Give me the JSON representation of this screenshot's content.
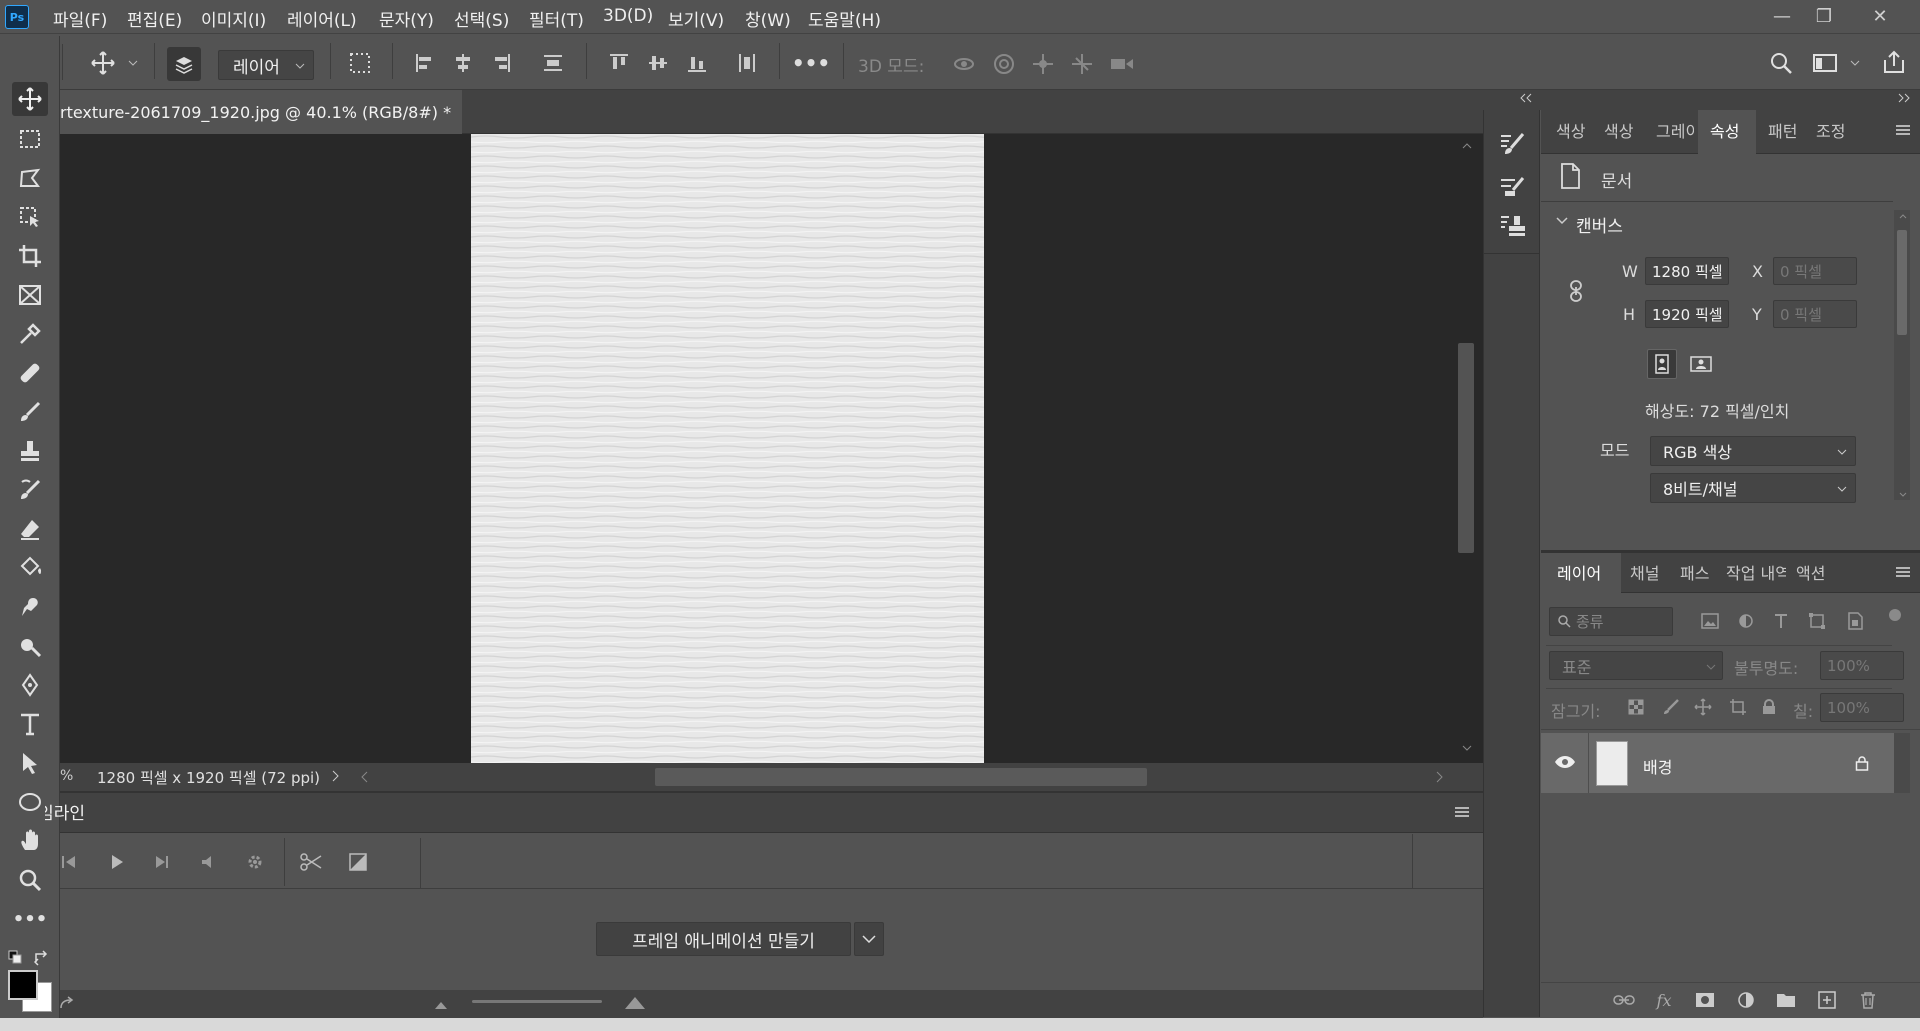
{
  "app": {
    "logo": "Ps"
  },
  "menu": [
    "파일(F)",
    "편집(E)",
    "이미지(I)",
    "레이어(L)",
    "문자(Y)",
    "선택(S)",
    "필터(T)",
    "3D(D)",
    "보기(V)",
    "창(W)",
    "도움말(H)"
  ],
  "window_controls": {
    "minimize": "—",
    "restore": "❐",
    "close": "✕"
  },
  "options_bar": {
    "layer_select": "레이어",
    "mode_label": "3D 모드:"
  },
  "document": {
    "tab_title": "rtexture-2061709_1920.jpg @ 40.1% (RGB/8#) *",
    "close": "×",
    "status_zoom": "%",
    "status_info": "1280 픽셀 x 1920 픽셀 (72 ppi)"
  },
  "timeline": {
    "title": "타임라인",
    "create_button": "프레임 애니메이션 만들기"
  },
  "properties": {
    "tabs": [
      "색상",
      "색상",
      "그레이",
      "속성",
      "패턴",
      "조정"
    ],
    "active_tab": 3,
    "doc_label": "문서",
    "canvas_section": "캔버스",
    "w_label": "W",
    "w_value": "1280 픽셀",
    "h_label": "H",
    "h_value": "1920 픽셀",
    "x_label": "X",
    "x_value": "0 픽셀",
    "y_label": "Y",
    "y_value": "0 픽셀",
    "resolution": "해상도: 72 픽셀/인치",
    "mode_label": "모드",
    "mode_value": "RGB 색상",
    "depth_value": "8비트/채널"
  },
  "layers": {
    "tabs": [
      "레이어",
      "채널",
      "패스",
      "작업 내역",
      "액션"
    ],
    "active_tab": 0,
    "filter_placeholder": "종류",
    "blend_mode": "표준",
    "opacity_label": "불투명도:",
    "opacity_value": "100%",
    "lock_label": "잠그기:",
    "fill_label": "칠:",
    "fill_value": "100%",
    "items": [
      {
        "name": "배경",
        "visible": true,
        "locked": true
      }
    ]
  },
  "colors": {
    "foreground": "#000000",
    "background": "#ffffff",
    "panel": "#535353",
    "dark": "#424242",
    "canvas_bg": "#282828"
  }
}
